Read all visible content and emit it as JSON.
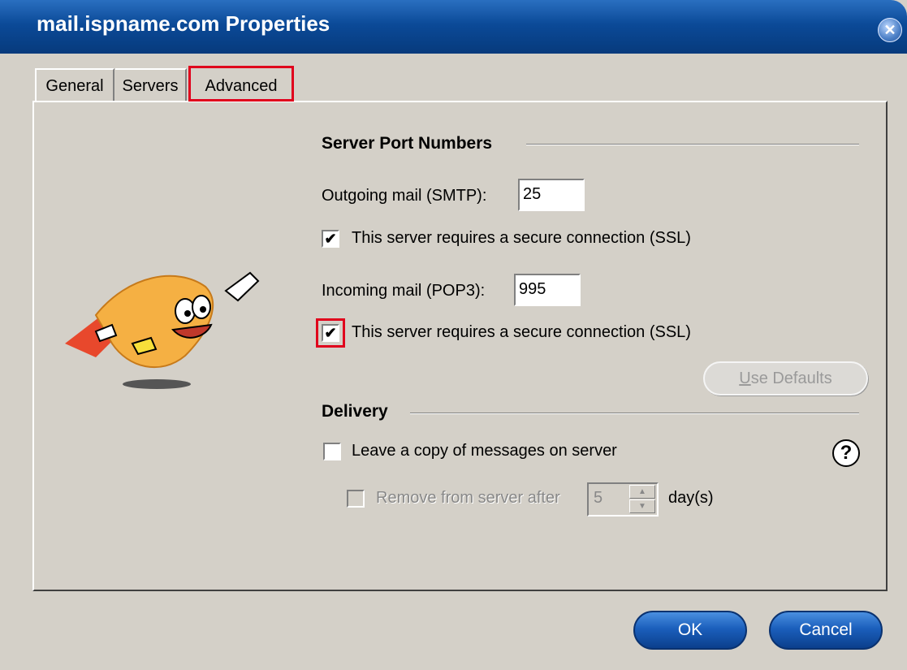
{
  "window": {
    "title": "mail.ispname.com Properties",
    "close_icon": "close-icon"
  },
  "tabs": [
    {
      "label": "General",
      "selected": false
    },
    {
      "label": "Servers",
      "selected": false
    },
    {
      "label": "Advanced",
      "selected": true
    }
  ],
  "port_section": {
    "title": "Server Port Numbers",
    "outgoing_label": "Outgoing mail (SMTP):",
    "outgoing_value": "25",
    "outgoing_ssl_label": "This server requires a secure connection (SSL)",
    "outgoing_ssl_checked": true,
    "incoming_label": "Incoming mail (POP3):",
    "incoming_value": "995",
    "incoming_ssl_label": "This server requires a secure connection (SSL)",
    "incoming_ssl_checked": true,
    "use_defaults_prefix": "U",
    "use_defaults_rest": "se Defaults"
  },
  "delivery": {
    "title": "Delivery",
    "leave_copy_label": "Leave a copy of messages on server",
    "leave_copy_checked": false,
    "remove_label": "Remove from server after",
    "remove_checked": false,
    "remove_days": "5",
    "days_label": "day(s)"
  },
  "buttons": {
    "ok": "OK",
    "cancel": "Cancel"
  },
  "colors": {
    "titlebar": "#0b4a98",
    "highlight": "#e0001c",
    "button": "#1b5fbc",
    "face": "#d4d0c8"
  }
}
